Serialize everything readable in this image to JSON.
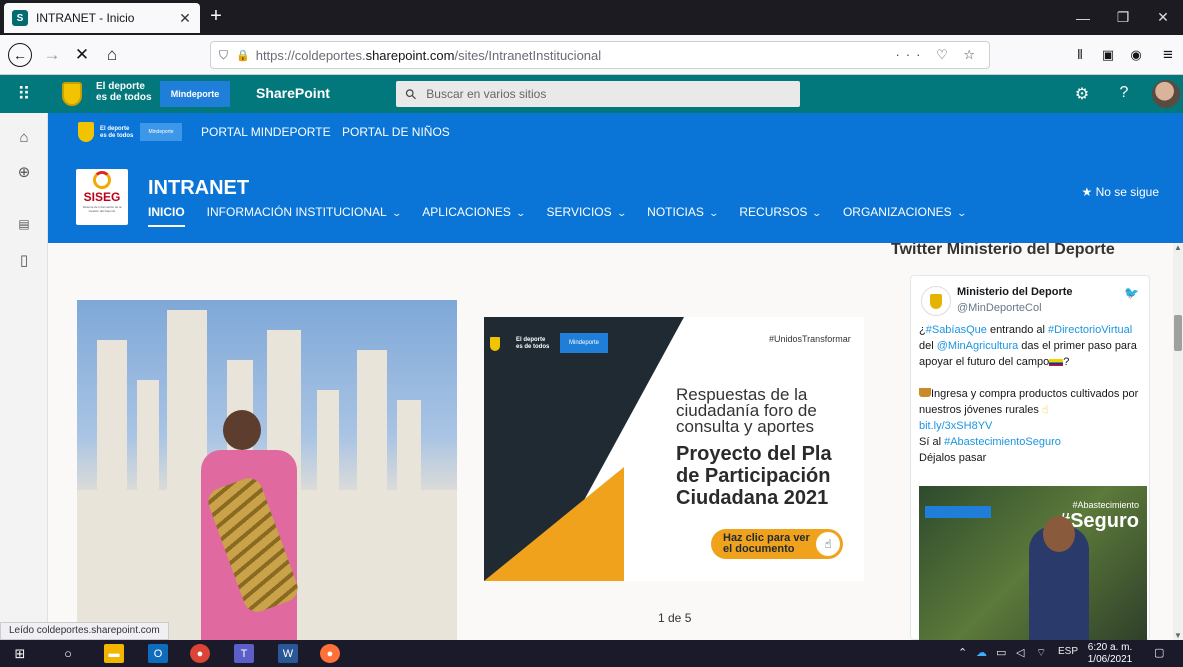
{
  "browser": {
    "tab_title": "INTRANET - Inicio",
    "tab_favicon_letter": "S",
    "tab_close": "✕",
    "new_tab": "+",
    "url_prefix": "https://coldeportes.",
    "url_host": "sharepoint.com",
    "url_path": "/sites/IntranetInstitucional",
    "url_actions": "··· ♡ ☆",
    "status_text": "Leído coldeportes.sharepoint.com"
  },
  "suite": {
    "brand_line1": "El deporte",
    "brand_line2": "es de todos",
    "brand_box": "Mindeporte",
    "app_name": "SharePoint",
    "search_placeholder": "Buscar en varios sitios",
    "help": "?"
  },
  "hub": {
    "brand_line1": "El deporte",
    "brand_line2": "es de todos",
    "brand_box": "Mindeporte",
    "links": [
      "PORTAL MINDEPORTE",
      "PORTAL DE NIÑOS"
    ]
  },
  "site": {
    "logo_text": "SISEG",
    "logo_sub": "Sistema de Información de la Gestión del Deporte",
    "title": "INTRANET",
    "nav": [
      "INICIO",
      "INFORMACIÓN INSTITUCIONAL",
      "APLICACIONES",
      "SERVICIOS",
      "NOTICIAS",
      "RECURSOS",
      "ORGANIZACIONES"
    ],
    "follow": "★ No se sigue"
  },
  "carousel": {
    "hashtag": "#UnidosTransformar",
    "brand_line1": "El deporte",
    "brand_line2": "es de todos",
    "brand_box": "Mindeporte",
    "subtitle": "Respuestas de la\nciudadanía foro de\nconsulta y aportes",
    "headline": "Proyecto del Pla\nde Participación\nCiudadana 2021",
    "cta": "Haz clic para ver el documento",
    "pager": "1 de 5"
  },
  "twitter": {
    "heading": "Twitter Ministerio del Deporte",
    "name": "Ministerio del Deporte",
    "handle": "@MinDeporteCol",
    "t1": "¿",
    "tag1": "#SabíasQue",
    "t2": " entrando al ",
    "tag2": "#DirectorioVirtual",
    "t3": " del ",
    "tag3": "@MinAgricultura",
    "t4": " das el primer paso para apoyar el futuro del campo",
    "t4b": "?",
    "t5": "Ingresa y compra productos cultivados por nuestros jóvenes rurales",
    "link": "bit.ly/3xSH8YV",
    "t6": "Sí al ",
    "tag4": "#AbastecimientoSeguro",
    "t7": "Déjalos pasar",
    "img_tag1": "#Abastecimiento",
    "img_tag2": "#Seguro"
  },
  "taskbar": {
    "lang": "ESP",
    "time": "6:20 a. m.",
    "date": "1/06/2021"
  },
  "colors": {
    "suite_bar": "#03787c",
    "hub_blue": "#0a75d6",
    "accent_orange": "#f0a21c"
  }
}
